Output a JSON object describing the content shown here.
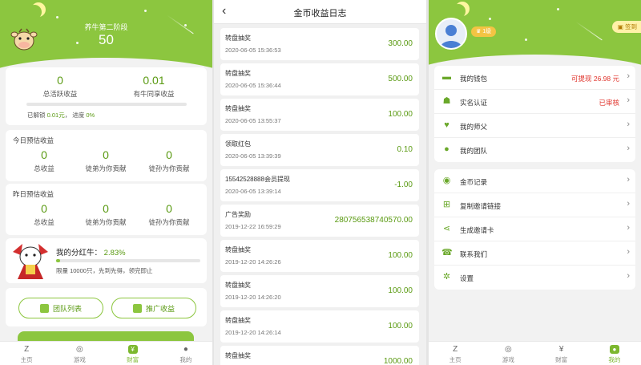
{
  "home": {
    "stage_title": "养牛第二阶段",
    "stage_value": "50",
    "active_income_value": "0",
    "active_income_label": "总活跃收益",
    "cow_share_value": "0.01",
    "cow_share_label": "有牛同享收益",
    "unlocked_prefix": "已解锁",
    "unlocked_amount": "0.01元",
    "progress_label": "进度",
    "progress_value": "0%",
    "progress_fraction": 0,
    "today_title": "今日预估收益",
    "yesterday_title": "昨日预估收益",
    "est_columns": [
      {
        "value": "0",
        "label": "总收益"
      },
      {
        "value": "0",
        "label": "徒弟为你贡献"
      },
      {
        "value": "0",
        "label": "徒孙为你贡献"
      }
    ],
    "yesterday_columns": [
      {
        "value": "0",
        "label": "总收益"
      },
      {
        "value": "0",
        "label": "徒弟为你贡献"
      },
      {
        "value": "0",
        "label": "徒孙为你贡献"
      }
    ],
    "dividend_label": "我的分红牛：",
    "dividend_value": "2.83%",
    "dividend_fraction": 0.0283,
    "dividend_note": "限量 10000只，先到先得，领完即止",
    "team_list_button": "团队列表",
    "promo_income_button": "推广收益"
  },
  "tabs": [
    {
      "label": "主页",
      "icon": "z-logo-icon"
    },
    {
      "label": "游戏",
      "icon": "gamepad-icon"
    },
    {
      "label": "财富",
      "icon": "money-bag-icon"
    },
    {
      "label": "我的",
      "icon": "user-icon"
    }
  ],
  "log": {
    "title": "金币收益日志",
    "items": [
      {
        "title": "转盘抽奖",
        "date": "2020-06-05 15:36:53",
        "value": "300.00"
      },
      {
        "title": "转盘抽奖",
        "date": "2020-06-05 15:36:44",
        "value": "500.00"
      },
      {
        "title": "转盘抽奖",
        "date": "2020-06-05 13:55:37",
        "value": "100.00"
      },
      {
        "title": "领取红包",
        "date": "2020-06-05 13:39:39",
        "value": "0.10"
      },
      {
        "title": "15542528888会员提现",
        "date": "2020-06-05 13:39:14",
        "value": "-1.00"
      },
      {
        "title": "广告奖励",
        "date": "2019-12-22 16:59:29",
        "value": "280756538740570.00"
      },
      {
        "title": "转盘抽奖",
        "date": "2019-12-20 14:26:26",
        "value": "100.00"
      },
      {
        "title": "转盘抽奖",
        "date": "2019-12-20 14:26:20",
        "value": "100.00"
      },
      {
        "title": "转盘抽奖",
        "date": "2019-12-20 14:26:14",
        "value": "100.00"
      },
      {
        "title": "转盘抽奖",
        "date": "",
        "value": "1000.00"
      }
    ]
  },
  "profile": {
    "level_badge": "1级",
    "sign_badge": "签到",
    "menu_group1": [
      {
        "label": "我的钱包",
        "right": "可提现 26.98 元",
        "icon": "wallet-icon"
      },
      {
        "label": "实名认证",
        "right": "已审核",
        "icon": "id-card-icon"
      },
      {
        "label": "我的师父",
        "right": "",
        "icon": "master-icon"
      },
      {
        "label": "我的团队",
        "right": "",
        "icon": "team-icon"
      }
    ],
    "menu_group2": [
      {
        "label": "金币记录",
        "right": "",
        "icon": "coins-icon"
      },
      {
        "label": "复制邀请链接",
        "right": "",
        "icon": "copy-link-icon"
      },
      {
        "label": "生成邀请卡",
        "right": "",
        "icon": "share-icon"
      },
      {
        "label": "联系我们",
        "right": "",
        "icon": "contact-icon"
      },
      {
        "label": "设置",
        "right": "",
        "icon": "gear-icon"
      }
    ]
  },
  "colors": {
    "brand_green": "#8cc63f",
    "text_green": "#5a9a12",
    "alert_red": "#e0342c"
  }
}
